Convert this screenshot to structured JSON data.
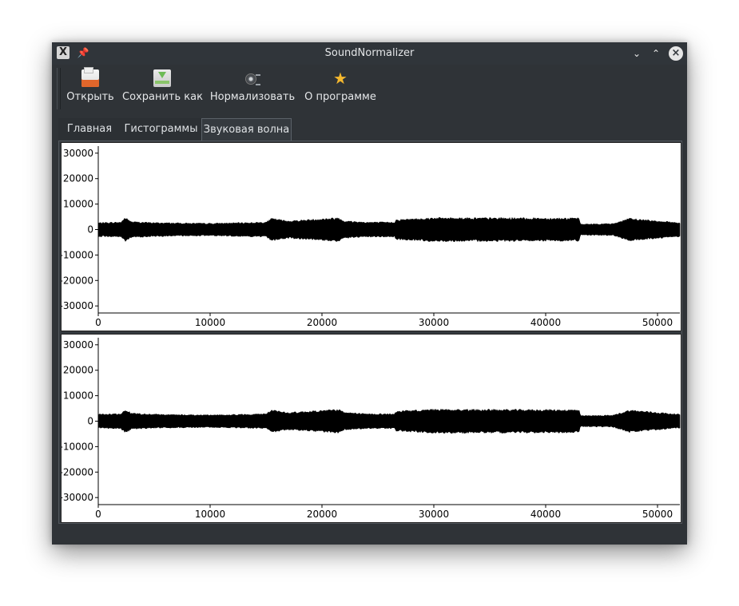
{
  "window": {
    "title": "SoundNormalizer"
  },
  "titlebar": {
    "app_icon": "x-app-icon",
    "pin_icon": "pin-icon",
    "min_glyph": "⌄",
    "max_glyph": "⌃",
    "close_glyph": "×"
  },
  "toolbar": {
    "open_label": "Открыть",
    "save_label": "Сохранить как",
    "normalize_label": "Нормализовать",
    "about_label": "О программе"
  },
  "tabs": [
    {
      "label": "Главная",
      "active": false
    },
    {
      "label": "Гистограммы",
      "active": false
    },
    {
      "label": "Звуковая волна",
      "active": true
    }
  ],
  "colors": {
    "window_bg": "#2f3337",
    "plot_bg": "#ffffff",
    "waveform": "#000000"
  },
  "chart_data": [
    {
      "type": "area",
      "x_ticks": [
        "0",
        "10000",
        "20000",
        "30000",
        "40000",
        "50000"
      ],
      "y_ticks": [
        "30000",
        "20000",
        "10000",
        "0",
        "-10000",
        "-20000",
        "-30000"
      ],
      "xlim": [
        0,
        52000
      ],
      "ylim": [
        -32768,
        32767
      ],
      "envelope": {
        "x": [
          0,
          2000,
          2400,
          3000,
          5000,
          10000,
          12000,
          15000,
          15500,
          17000,
          21500,
          22000,
          24000,
          26500,
          26600,
          30000,
          43000,
          43100,
          46000,
          47500,
          52000
        ],
        "amplitude": [
          2800,
          3000,
          4800,
          3200,
          2800,
          2500,
          2700,
          3000,
          4500,
          3500,
          4800,
          3500,
          3000,
          3000,
          4000,
          4800,
          4600,
          2200,
          2400,
          4500,
          2800
        ]
      }
    },
    {
      "type": "area",
      "x_ticks": [
        "0",
        "10000",
        "20000",
        "30000",
        "40000",
        "50000"
      ],
      "y_ticks": [
        "30000",
        "20000",
        "10000",
        "0",
        "-10000",
        "-20000",
        "-30000"
      ],
      "xlim": [
        0,
        52000
      ],
      "ylim": [
        -32768,
        32767
      ],
      "envelope": {
        "x": [
          0,
          2000,
          2400,
          3000,
          5000,
          10000,
          12000,
          15000,
          15500,
          17000,
          21500,
          22000,
          24000,
          26500,
          26600,
          30000,
          43000,
          43100,
          46000,
          47500,
          52000
        ],
        "amplitude": [
          2800,
          3000,
          4800,
          3200,
          2800,
          2500,
          2700,
          3000,
          4500,
          3500,
          4800,
          3500,
          3000,
          3000,
          4000,
          4800,
          4600,
          2200,
          2400,
          4500,
          2800
        ]
      }
    }
  ]
}
